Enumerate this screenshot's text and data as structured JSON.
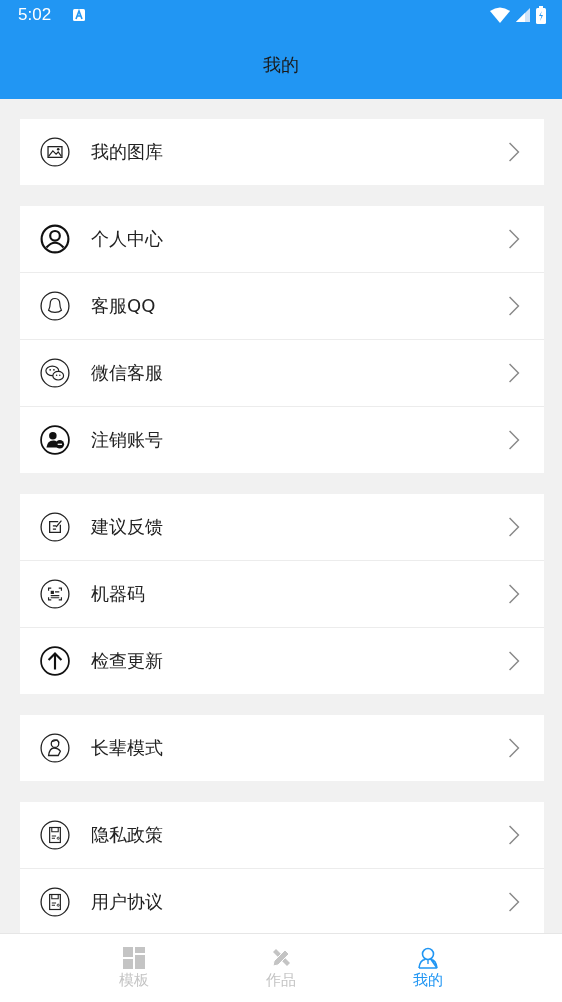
{
  "status_bar": {
    "time": "5:02"
  },
  "header": {
    "title": "我的"
  },
  "sections": [
    {
      "items": [
        {
          "label": "我的图库"
        }
      ]
    },
    {
      "items": [
        {
          "label": "个人中心"
        },
        {
          "label": "客服QQ"
        },
        {
          "label": "微信客服"
        },
        {
          "label": "注销账号"
        }
      ]
    },
    {
      "items": [
        {
          "label": "建议反馈"
        },
        {
          "label": "机器码"
        },
        {
          "label": "检查更新"
        }
      ]
    },
    {
      "items": [
        {
          "label": "长辈模式"
        }
      ]
    },
    {
      "items": [
        {
          "label": "隐私政策"
        },
        {
          "label": "用户协议"
        }
      ]
    }
  ],
  "tabs": [
    {
      "label": "模板",
      "selected": false
    },
    {
      "label": "作品",
      "selected": false
    },
    {
      "label": "我的",
      "selected": true
    }
  ]
}
